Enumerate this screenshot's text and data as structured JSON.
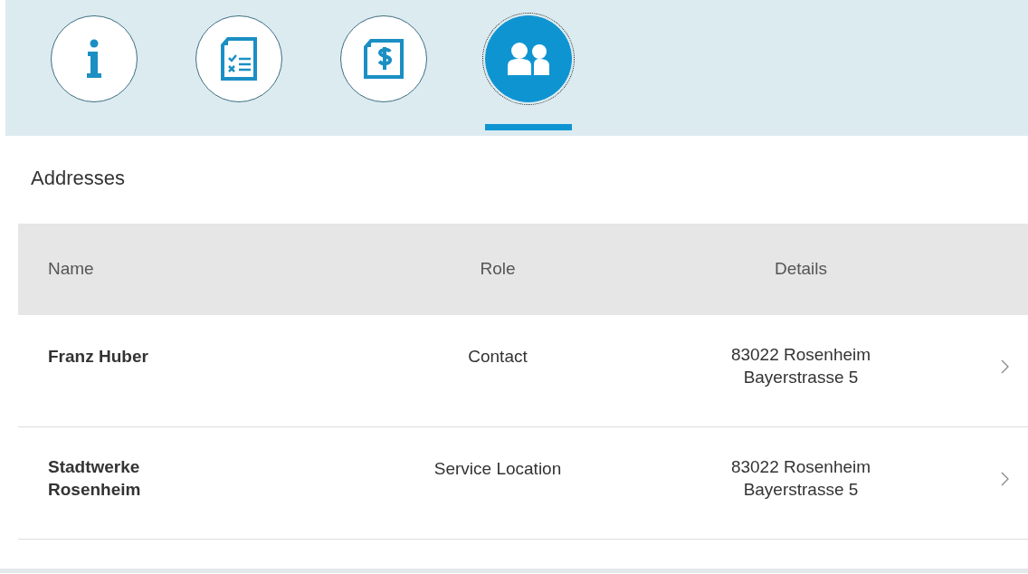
{
  "tabs": [
    {
      "kind": "info",
      "selected": false
    },
    {
      "kind": "checklist",
      "selected": false
    },
    {
      "kind": "invoice",
      "selected": false
    },
    {
      "kind": "people",
      "selected": true
    }
  ],
  "section_title": "Addresses",
  "table": {
    "columns": [
      "Name",
      "Role",
      "Details"
    ],
    "rows": [
      {
        "name": "Franz Huber",
        "role": "Contact",
        "details": [
          "83022 Rosenheim",
          "Bayerstrasse 5"
        ]
      },
      {
        "name": "Stadtwerke Rosenheim",
        "role": "Service Location",
        "details": [
          "83022 Rosenheim",
          "Bayerstrasse 5"
        ]
      }
    ]
  }
}
